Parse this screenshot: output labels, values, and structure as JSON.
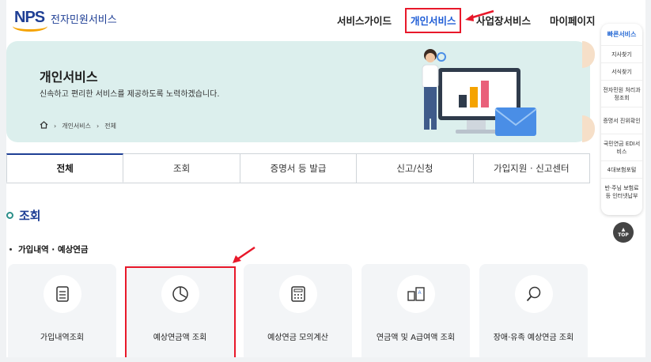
{
  "header": {
    "logo_text": "NPS",
    "logo_subtitle": "전자민원서비스",
    "nav": [
      {
        "label": "서비스가이드",
        "active": false
      },
      {
        "label": "개인서비스",
        "active": true
      },
      {
        "label": "사업장서비스",
        "active": false
      },
      {
        "label": "마이페이지",
        "active": false
      }
    ]
  },
  "banner": {
    "title": "개인서비스",
    "description": "신속하고 편리한 서비스를 제공하도록 노력하겠습니다.",
    "breadcrumb": [
      "개인서비스",
      "전체"
    ]
  },
  "tabs": [
    "전체",
    "조회",
    "증명서 등 발급",
    "신고/신청",
    "가입지원 · 신고센터"
  ],
  "active_tab": "전체",
  "section": {
    "title": "조회",
    "subtitle": "가입내역 · 예상연금"
  },
  "cards": [
    {
      "label": "가입내역조회",
      "icon": "document-icon"
    },
    {
      "label": "예상연금액 조회",
      "icon": "pie-chart-icon"
    },
    {
      "label": "예상연금 모의계산",
      "icon": "calculator-icon"
    },
    {
      "label": "연금액 및 A급여액 조회",
      "icon": "compare-icon"
    },
    {
      "label": "장애·유족 예상연금 조회",
      "icon": "magnifier-icon"
    }
  ],
  "quick_menu": {
    "title": "빠른서비스",
    "items": [
      "지사찾기",
      "서식찾기",
      "전자민원 처리과정조회",
      "증명서 진위확인",
      "국민연금 EDI서비스",
      "4대보험포털",
      "반·주님 보험료 등 인터넷납부"
    ]
  },
  "top_button": "TOP",
  "colors": {
    "brand_blue": "#1f3f95",
    "active_blue": "#1f5dd6",
    "banner_bg": "#dcefed",
    "highlight_red": "#e8182a",
    "accent_orange": "#f5a300"
  }
}
